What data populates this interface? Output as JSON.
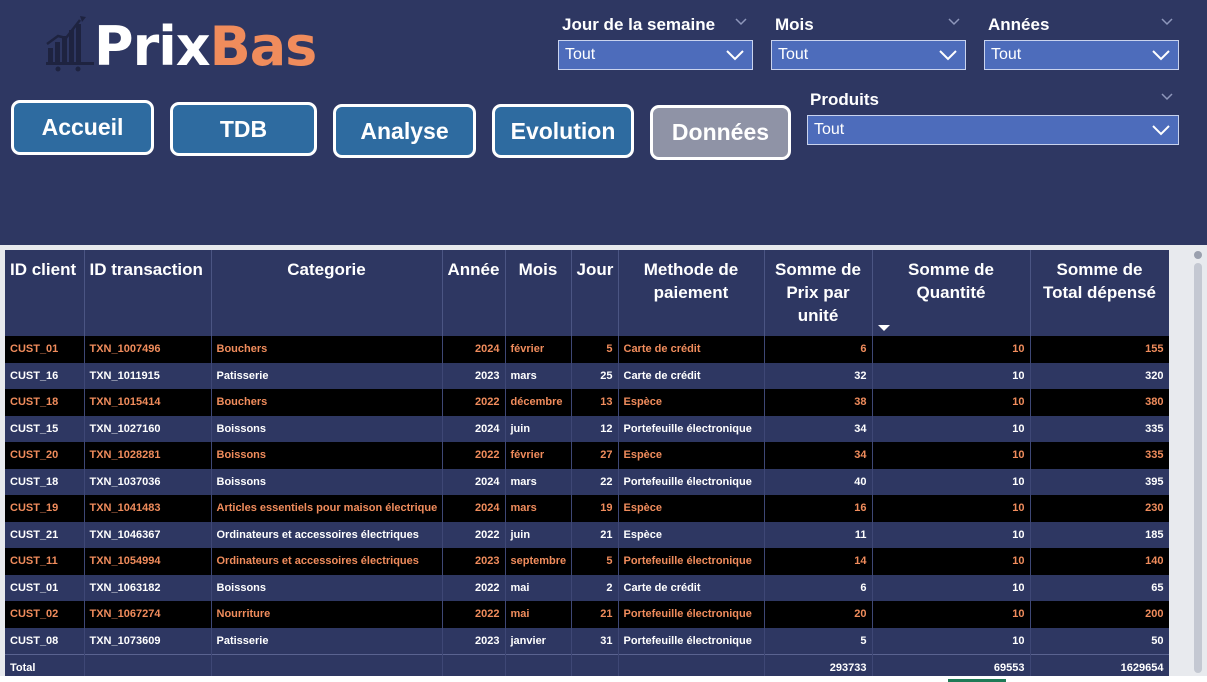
{
  "brand": {
    "part1": "Prix",
    "part2": "Bas",
    "icon": "chart-cart-logo-icon"
  },
  "nav": [
    {
      "label": "Accueil",
      "active": false
    },
    {
      "label": "TDB",
      "active": false
    },
    {
      "label": "Analyse",
      "active": false
    },
    {
      "label": "Evolution",
      "active": false
    },
    {
      "label": "Données",
      "active": true
    }
  ],
  "filters": {
    "jour": {
      "title": "Jour de la semaine",
      "value": "Tout"
    },
    "mois": {
      "title": "Mois",
      "value": "Tout"
    },
    "annees": {
      "title": "Années",
      "value": "Tout"
    },
    "produits": {
      "title": "Produits",
      "value": "Tout"
    }
  },
  "table": {
    "headers": [
      "ID client",
      "ID transaction",
      "Categorie",
      "Année",
      "Mois",
      "Jour",
      "Methode de paiement",
      "Somme de Prix par unité",
      "Somme de Quantité",
      "Somme de Total dépensé"
    ],
    "rows": [
      [
        "CUST_01",
        "TXN_1007496",
        "Bouchers",
        "2024",
        "février",
        "5",
        "Carte de crédit",
        "6",
        "10",
        "155"
      ],
      [
        "CUST_16",
        "TXN_1011915",
        "Patisserie",
        "2023",
        "mars",
        "25",
        "Carte de crédit",
        "32",
        "10",
        "320"
      ],
      [
        "CUST_18",
        "TXN_1015414",
        "Bouchers",
        "2022",
        "décembre",
        "13",
        "Espèce",
        "38",
        "10",
        "380"
      ],
      [
        "CUST_15",
        "TXN_1027160",
        "Boissons",
        "2024",
        "juin",
        "12",
        "Portefeuille électronique",
        "34",
        "10",
        "335"
      ],
      [
        "CUST_20",
        "TXN_1028281",
        "Boissons",
        "2022",
        "février",
        "27",
        "Espèce",
        "34",
        "10",
        "335"
      ],
      [
        "CUST_18",
        "TXN_1037036",
        "Boissons",
        "2024",
        "mars",
        "22",
        "Portefeuille électronique",
        "40",
        "10",
        "395"
      ],
      [
        "CUST_19",
        "TXN_1041483",
        "Articles essentiels pour maison électrique",
        "2024",
        "mars",
        "19",
        "Espèce",
        "16",
        "10",
        "230"
      ],
      [
        "CUST_21",
        "TXN_1046367",
        "Ordinateurs et accessoires électriques",
        "2022",
        "juin",
        "21",
        "Espèce",
        "11",
        "10",
        "185"
      ],
      [
        "CUST_11",
        "TXN_1054994",
        "Ordinateurs et accessoires électriques",
        "2023",
        "septembre",
        "5",
        "Portefeuille électronique",
        "14",
        "10",
        "140"
      ],
      [
        "CUST_01",
        "TXN_1063182",
        "Boissons",
        "2022",
        "mai",
        "2",
        "Carte de crédit",
        "6",
        "10",
        "65"
      ],
      [
        "CUST_02",
        "TXN_1067274",
        "Nourriture",
        "2022",
        "mai",
        "21",
        "Portefeuille électronique",
        "20",
        "10",
        "200"
      ],
      [
        "CUST_08",
        "TXN_1073609",
        "Patisserie",
        "2023",
        "janvier",
        "31",
        "Portefeuille électronique",
        "5",
        "10",
        "50"
      ]
    ],
    "total": {
      "label": "Total",
      "prix": "293733",
      "quantite": "69553",
      "total_depense": "1629654"
    }
  },
  "colors": {
    "background": "#2e3762",
    "accent": "#f08c5c",
    "button": "#2e6ba0",
    "slicer": "#4d6cbb"
  }
}
